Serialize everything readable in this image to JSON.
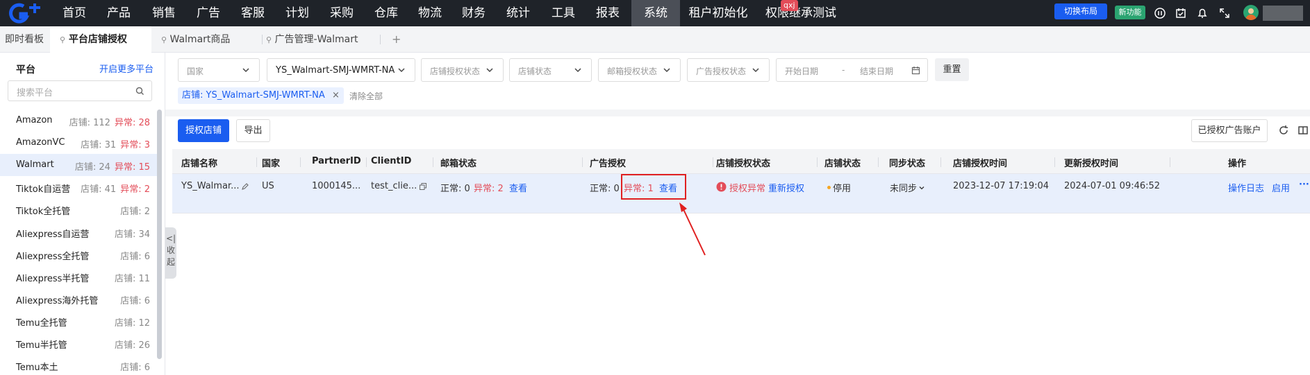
{
  "topnav": {
    "items": [
      "首页",
      "产品",
      "销售",
      "广告",
      "客服",
      "计划",
      "采购",
      "仓库",
      "物流",
      "财务",
      "统计",
      "工具",
      "报表",
      "系统",
      "租户初始化",
      "权限继承测试"
    ],
    "active": "系统",
    "badge": "qxj",
    "switch_layout": "切换布局",
    "new_feature": "新功能"
  },
  "tabbar": {
    "dashboard": "即时看板",
    "tabs": [
      "平台店铺授权",
      "Walmart商品",
      "广告管理-Walmart"
    ],
    "add": "+"
  },
  "sidebar": {
    "title": "平台",
    "more_link": "开启更多平台",
    "search_placeholder": "搜索平台",
    "items": [
      {
        "name": "Amazon",
        "count": "店铺: 112",
        "error": "异常: 28"
      },
      {
        "name": "AmazonVC",
        "count": "店铺: 31",
        "error": "异常: 3"
      },
      {
        "name": "Walmart",
        "count": "店铺: 24",
        "error": "异常: 15"
      },
      {
        "name": "Tiktok自运营",
        "count": "店铺: 41",
        "error": "异常: 2"
      },
      {
        "name": "Tiktok全托管",
        "count": "店铺: 2",
        "error": ""
      },
      {
        "name": "Aliexpress自运营",
        "count": "店铺: 34",
        "error": ""
      },
      {
        "name": "Aliexpress全托管",
        "count": "店铺: 6",
        "error": ""
      },
      {
        "name": "Aliexpress半托管",
        "count": "店铺: 11",
        "error": ""
      },
      {
        "name": "Aliexpress海外托管",
        "count": "店铺: 6",
        "error": ""
      },
      {
        "name": "Temu全托管",
        "count": "店铺: 12",
        "error": ""
      },
      {
        "name": "Temu半托管",
        "count": "店铺: 26",
        "error": ""
      },
      {
        "name": "Temu本土",
        "count": "店铺: 6",
        "error": ""
      }
    ],
    "active_index": 2,
    "collapse": [
      "<|",
      "收",
      "起"
    ]
  },
  "filters": {
    "country": "国家",
    "store": "YS_Walmart-SMJ-WMRT-NA",
    "store_auth_status": "店铺授权状态",
    "store_status": "店铺状态",
    "mail_auth_status": "邮箱授权状态",
    "ad_auth_status": "广告授权状态",
    "start_date": "开始日期",
    "date_sep": "-",
    "end_date": "结束日期",
    "reset": "重置",
    "chip": "店铺: YS_Walmart-SMJ-WMRT-NA",
    "clear_all": "清除全部"
  },
  "toolbar": {
    "authorize": "授权店铺",
    "export": "导出",
    "authorized_ads": "已授权广告账户"
  },
  "table": {
    "headers": [
      "店铺名称",
      "国家",
      "PartnerID",
      "ClientID",
      "邮箱状态",
      "广告授权",
      "店铺授权状态",
      "店铺状态",
      "同步状态",
      "店铺授权时间",
      "更新授权时间",
      "操作"
    ],
    "row": {
      "store": "YS_Walmar...",
      "country": "US",
      "partner_id": "1000145...",
      "client_id": "test_clie...",
      "mail_normal": "正常: 0",
      "mail_error": "异常: 2",
      "mail_view": "查看",
      "ad_normal": "正常: 0",
      "ad_error": "异常: 1",
      "ad_view": "查看",
      "auth_status": "授权异常",
      "reauth": "重新授权",
      "store_status": "停用",
      "sync_status": "未同步",
      "auth_time": "2023-12-07 17:19:04",
      "update_time": "2024-07-01 09:46:52",
      "op_log": "操作日志",
      "op_enable": "启用",
      "op_more": "···"
    }
  },
  "colors": {
    "nav_bg": "#1f2329",
    "primary": "#1a5df0",
    "danger": "#e34d59",
    "success": "#2ba471",
    "warn": "#f5a623"
  }
}
